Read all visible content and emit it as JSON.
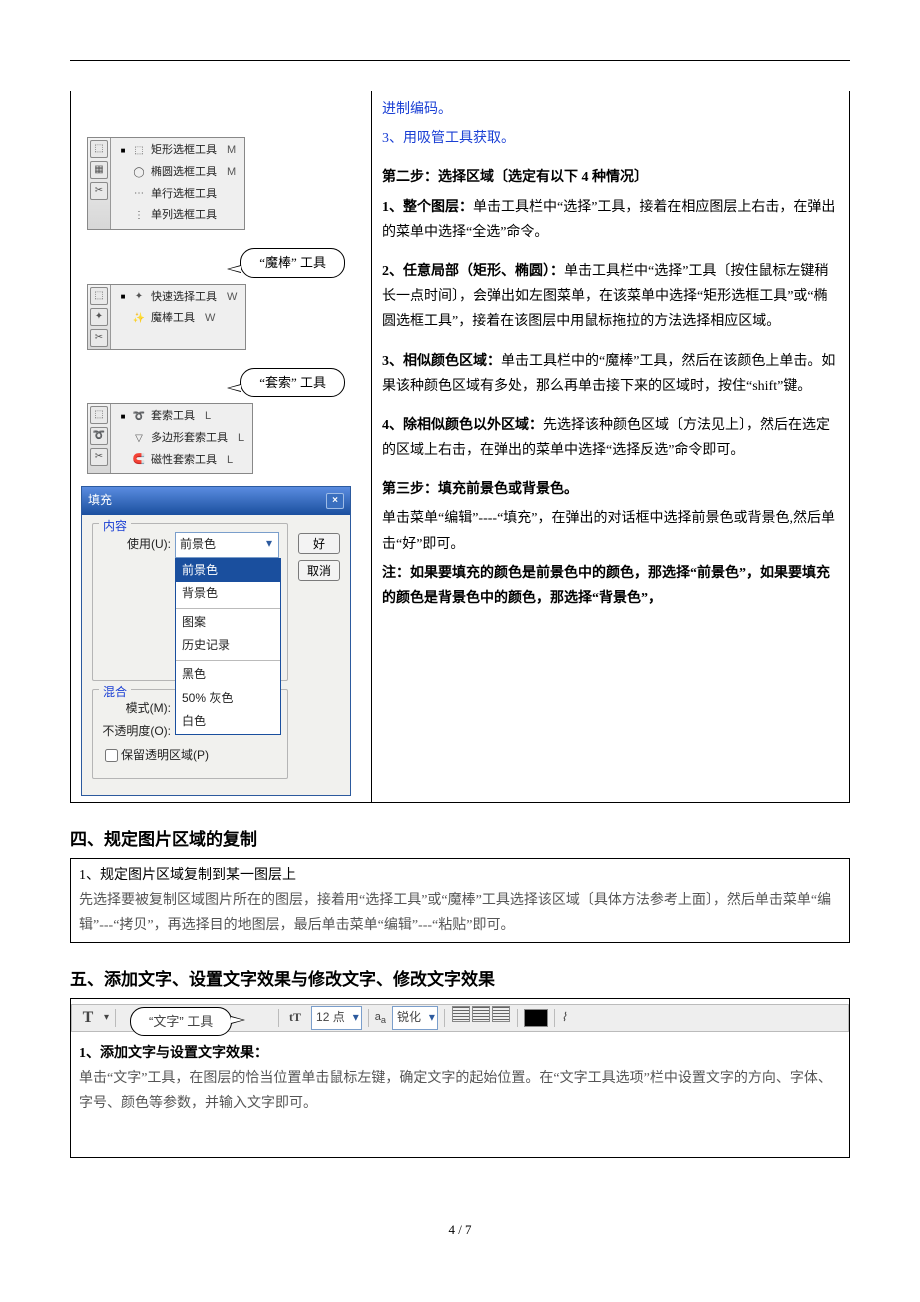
{
  "flyouts": {
    "marquee": {
      "items": [
        {
          "dot": "■",
          "label": "矩形选框工具",
          "key": "M"
        },
        {
          "dot": "",
          "label": "椭圆选框工具",
          "key": "M"
        },
        {
          "dot": "",
          "label": "单行选框工具",
          "key": ""
        },
        {
          "dot": "",
          "label": "单列选框工具",
          "key": ""
        }
      ]
    },
    "wand_callout": "“魔棒” 工具",
    "wand": {
      "items": [
        {
          "dot": "■",
          "label": "快速选择工具",
          "key": "W"
        },
        {
          "dot": "",
          "label": "魔棒工具",
          "key": "W"
        }
      ]
    },
    "lasso_callout": "“套索” 工具",
    "lasso": {
      "items": [
        {
          "dot": "■",
          "label": "套索工具",
          "key": "L"
        },
        {
          "dot": "",
          "label": "多边形套索工具",
          "key": "L"
        },
        {
          "dot": "",
          "label": "磁性套索工具",
          "key": "L"
        }
      ]
    }
  },
  "fill_dialog": {
    "title": "填充",
    "group_content": "内容",
    "use_label": "使用(U):",
    "use_value": "前景色",
    "options": [
      "前景色",
      "背景色",
      "—",
      "图案",
      "历史记录",
      "—",
      "黑色",
      "50% 灰色",
      "白色"
    ],
    "group_blend": "混合",
    "mode_label": "模式(M):",
    "opacity_label": "不透明度(O):",
    "preserve_label": "保留透明区域(P)",
    "btn_ok": "好",
    "btn_cancel": "取消"
  },
  "right_col": {
    "l1": "进制编码。",
    "l2": "3、用吸管工具获取。",
    "step2_title": "第二步：选择区域〔选定有以下 4 种情况〕",
    "p1a": "1、整个图层：",
    "p1b": "单击工具栏中“选择”工具，接着在相应图层上右击，在弹出的菜单中选择“全选”命令。",
    "p2a": "2、任意局部（矩形、椭圆）：",
    "p2b": "单击工具栏中“选择”工具〔按住鼠标左键稍长一点时间〕，会弹出如左图菜单，在该菜单中选择“矩形选框工具”或“椭圆选框工具”，接着在该图层中用鼠标拖拉的方法选择相应区域。",
    "p3a": "3、相似颜色区域：",
    "p3b": "单击工具栏中的“魔棒”工具，然后在该颜色上单击。如果该种颜色区域有多处，那么再单击接下来的区域时，按住“shift”键。",
    "p4a": "4、除相似颜色以外区域：",
    "p4b": "先选择该种颜色区域〔方法见上〕，然后在选定的区域上右击，在弹出的菜单中选择“选择反选”命令即可。",
    "step3_title": "第三步：填充前景色或背景色。",
    "p5": "单击菜单“编辑”----“填充”，在弹出的对话框中选择前景色或背景色,然后单击“好”即可。",
    "note": "注：如果要填充的颜色是前景色中的颜色，那选择“前景色”，如果要填充的颜色是背景色中的颜色，那选择“背景色”，"
  },
  "sec4_title": "四、规定图片区域的复制",
  "sec4_sub": "1、规定图片区域复制到某一图层上",
  "sec4_body": "先选择要被复制区域图片所在的图层，接着用“选择工具”或“魔棒”工具选择该区域〔具体方法参考上面〕，然后单击菜单“编辑”---“拷贝”，再选择目的地图层，最后单击菜单“编辑”---“粘贴”即可。",
  "sec5_title": "五、添加文字、设置文字效果与修改文字、修改文字效果",
  "text_tool": {
    "callout": "“文字” 工具",
    "size": "12 点",
    "aa": "锐化"
  },
  "sec5_sub": "1、添加文字与设置文字效果：",
  "sec5_body": "单击“文字”工具，在图层的恰当位置单击鼠标左键，确定文字的起始位置。在“文字工具选项”栏中设置文字的方向、字体、字号、颜色等参数，并输入文字即可。",
  "page_no": "4 / 7"
}
